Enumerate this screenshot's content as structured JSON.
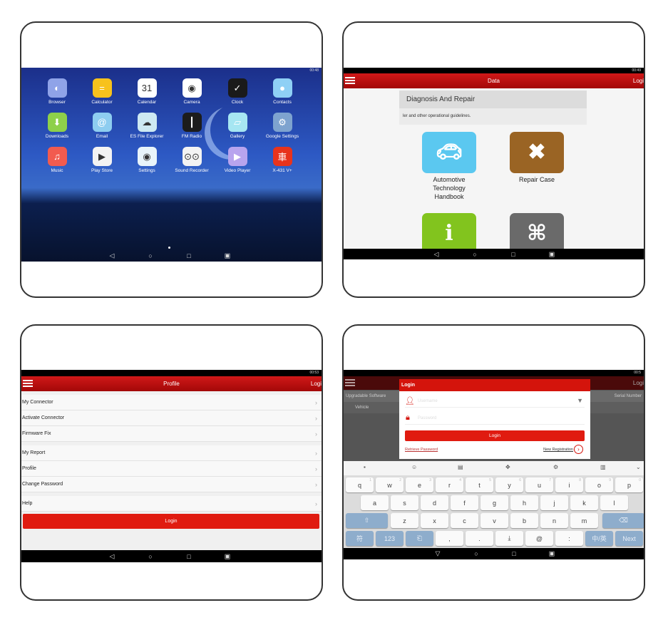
{
  "home": {
    "time": "00:48",
    "apps": [
      {
        "label": "Browser",
        "icon": "planet-icon",
        "glyph": "◐",
        "color": "#8fa3e8"
      },
      {
        "label": "Calculator",
        "icon": "calculator-icon",
        "glyph": "=",
        "color": "#f7c21c"
      },
      {
        "label": "Calendar",
        "icon": "calendar-icon",
        "glyph": "31",
        "color": "#ffffff"
      },
      {
        "label": "Camera",
        "icon": "camera-icon",
        "glyph": "◉",
        "color": "#ffffff"
      },
      {
        "label": "Clock",
        "icon": "clock-icon",
        "glyph": "✓",
        "color": "#1a1a1a"
      },
      {
        "label": "Contacts",
        "icon": "contact-icon",
        "glyph": "●",
        "color": "#8fd0f5"
      },
      {
        "label": "Downloads",
        "icon": "download-icon",
        "glyph": "⬇",
        "color": "#8ed04a"
      },
      {
        "label": "Email",
        "icon": "at-icon",
        "glyph": "@",
        "color": "#8ecdf0"
      },
      {
        "label": "ES File Explorer",
        "icon": "folder-cloud-icon",
        "glyph": "☁",
        "color": "#cde9f2"
      },
      {
        "label": "FM Radio",
        "icon": "radio-icon",
        "glyph": "┃",
        "color": "#1c1c1c"
      },
      {
        "label": "Gallery",
        "icon": "gallery-icon",
        "glyph": "▱",
        "color": "#a6e6f2"
      },
      {
        "label": "Google Settings",
        "icon": "gear-icon",
        "glyph": "⚙",
        "color": "#7ea3cf"
      },
      {
        "label": "Music",
        "icon": "headphones-icon",
        "glyph": "♫",
        "color": "#f25b4f"
      },
      {
        "label": "Play Store",
        "icon": "play-store-icon",
        "glyph": "▶",
        "color": "#f3f3f3"
      },
      {
        "label": "Settings",
        "icon": "settings-icon",
        "glyph": "◉",
        "color": "#e8f4fa"
      },
      {
        "label": "Sound Recorder",
        "icon": "recorder-icon",
        "glyph": "⊙⊙",
        "color": "#f3f3f3"
      },
      {
        "label": "Video Player",
        "icon": "video-icon",
        "glyph": "▶",
        "color": "#b8a4ee"
      },
      {
        "label": "X-431 V+",
        "icon": "x431-logo-icon",
        "glyph": "車",
        "color": "#e8331c"
      }
    ]
  },
  "data_screen": {
    "time": "00:49",
    "title": "Data",
    "login": "Logi",
    "section_title": "Diagnosis And Repair",
    "section_desc": "ler and other operational guidelines.",
    "tiles": [
      {
        "label": "Automotive Technology Handbook",
        "icon": "car-handbook-icon",
        "color": "#5bc8f0"
      },
      {
        "label": "Repair Case",
        "icon": "wrench-screwdriver-icon",
        "color": "#9a6424"
      },
      {
        "label": "",
        "icon": "info-icon",
        "color": "#82c41e"
      },
      {
        "label": "",
        "icon": "circuit-icon",
        "color": "#6a6a6a"
      }
    ]
  },
  "profile_screen": {
    "time": "00:53",
    "title": "Profile",
    "login": "Logi",
    "items": [
      "My Connector",
      "Activate Connector",
      "Firmware Fix",
      "My Report",
      "Profile",
      "Change Password",
      "Help"
    ],
    "login_button": "Login"
  },
  "login_screen": {
    "time": "00:5",
    "header_login": "Logi",
    "bg_col1": "Upgradable Software",
    "bg_col2": "Serial Number",
    "bg_row": "Vehicle",
    "dialog_title": "Login",
    "username_placeholder": "Username",
    "password_placeholder": "Password",
    "login_button": "Login",
    "retrieve_password": "Retrieve Password",
    "new_registration": "New Registration",
    "keyboard": {
      "row1": [
        "q",
        "w",
        "e",
        "r",
        "t",
        "y",
        "u",
        "i",
        "o",
        "p"
      ],
      "row1_hints": [
        "1",
        "2",
        "3",
        "4",
        "5",
        "6",
        "7",
        "8",
        "9",
        "0"
      ],
      "row2": [
        "a",
        "s",
        "d",
        "f",
        "g",
        "h",
        "j",
        "k",
        "l"
      ],
      "row3": [
        "z",
        "x",
        "c",
        "v",
        "b",
        "n",
        "m"
      ],
      "row4": [
        "符",
        "123",
        "⎗",
        ",",
        ".",
        "⤓",
        "@",
        ":",
        "中/英",
        "Next"
      ]
    }
  },
  "colors": {
    "accent": "#c80f0f",
    "dark_red": "#a30808"
  }
}
